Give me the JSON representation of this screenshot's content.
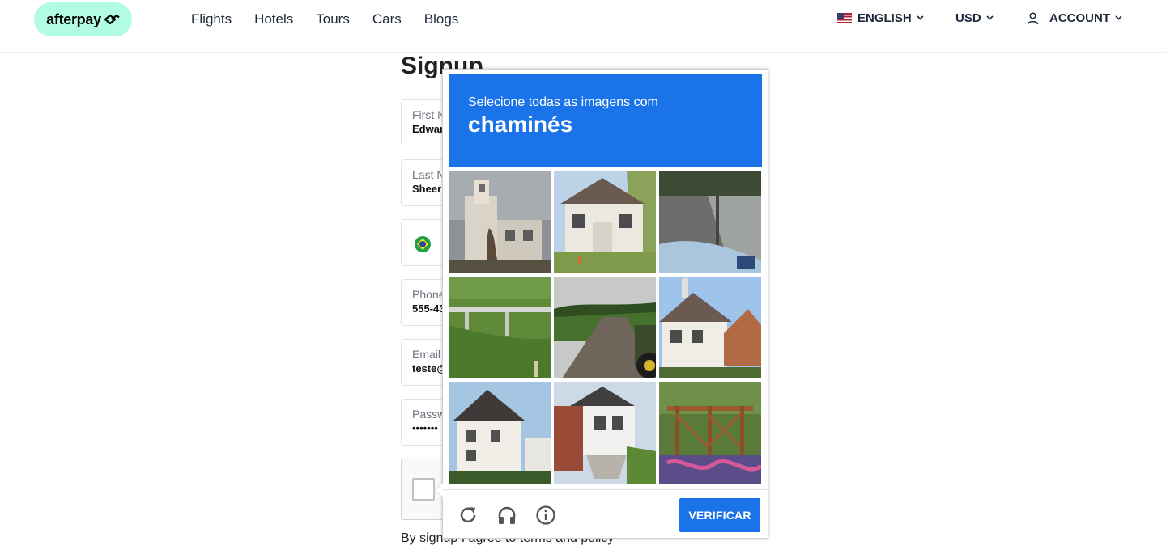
{
  "header": {
    "logo_text": "afterpay",
    "nav": [
      "Flights",
      "Hotels",
      "Tours",
      "Cars",
      "Blogs"
    ],
    "language": "ENGLISH",
    "currency": "USD",
    "account": "ACCOUNT"
  },
  "signup": {
    "title": "Signup",
    "fields": [
      {
        "label": "First N",
        "value": "Edwar"
      },
      {
        "label": "Last N",
        "value": "Sheer"
      },
      {
        "label": "",
        "value": ""
      },
      {
        "label": "Phone",
        "value": "555-43"
      },
      {
        "label": "Email",
        "value": "teste@"
      },
      {
        "label": "Passw",
        "value": "•••••••"
      }
    ],
    "terms": "By signup I agree to terms and policy"
  },
  "captcha": {
    "instruction": "Selecione todas as imagens com",
    "object": "chaminés",
    "verify_label": "VERIFICAR",
    "tiles": [
      "building-with-tower",
      "white-house-with-porch",
      "street-with-car-hood",
      "highway-bridge",
      "rural-road-with-tractor",
      "white-house-with-chimney",
      "white-house-gabled",
      "house-with-stairs",
      "wooden-pergola-graffiti"
    ]
  },
  "colors": {
    "brand_mint": "#b2fce4",
    "captcha_blue": "#1a73e8"
  }
}
